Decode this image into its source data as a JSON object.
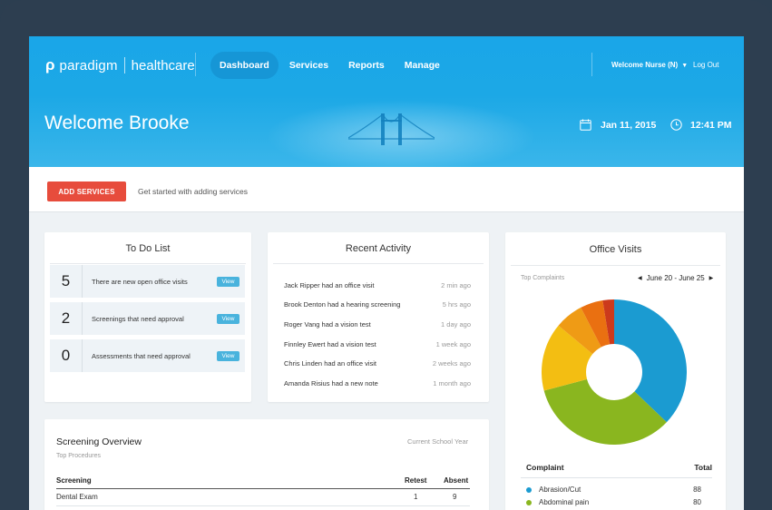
{
  "brand": {
    "logo_mark": "ρ",
    "name_part1": "paradigm",
    "name_part2": "healthcare"
  },
  "nav": {
    "items": [
      "Dashboard",
      "Services",
      "Reports",
      "Manage"
    ],
    "active": "Dashboard"
  },
  "user": {
    "welcome": "Welcome Nurse (N)",
    "logout": "Log Out"
  },
  "header": {
    "welcome": "Welcome Brooke",
    "date": "Jan 11, 2015",
    "time": "12:41 PM"
  },
  "actions": {
    "add_services": "ADD SERVICES",
    "hint": "Get started with adding services"
  },
  "todo": {
    "title": "To Do List",
    "items": [
      {
        "count": "5",
        "text": "There are new open office visits",
        "action": "View"
      },
      {
        "count": "2",
        "text": "Screenings that need approval",
        "action": "View"
      },
      {
        "count": "0",
        "text": "Assessments that need approval",
        "action": "View"
      }
    ]
  },
  "activity": {
    "title": "Recent Activity",
    "items": [
      {
        "text": "Jack Ripper had an office visit",
        "when": "2 min ago"
      },
      {
        "text": "Brook Denton had a hearing screening",
        "when": "5 hrs ago"
      },
      {
        "text": "Roger Vang had a vision test",
        "when": "1 day ago"
      },
      {
        "text": "Finnley Ewert had a vision test",
        "when": "1 week ago"
      },
      {
        "text": "Chris Linden had an office visit",
        "when": "2 weeks ago"
      },
      {
        "text": "Amanda Risius had a new note",
        "when": "1 month ago"
      }
    ]
  },
  "visits": {
    "title": "Office Visits",
    "subtitle": "Top Complaints",
    "range": "June 20 - June 25",
    "table_head": {
      "complaint": "Complaint",
      "total": "Total"
    },
    "rows": [
      {
        "label": "Abrasion/Cut",
        "total": "88",
        "color": "#1b9bd1"
      },
      {
        "label": "Abdominal pain",
        "total": "80",
        "color": "#8ab61f"
      }
    ]
  },
  "chart_data": {
    "type": "pie",
    "title": "Office Visits",
    "subtitle": "Top Complaints",
    "series": [
      {
        "name": "Abrasion/Cut",
        "value": 88,
        "color": "#1b9bd1"
      },
      {
        "name": "Abdominal pain",
        "value": 80,
        "color": "#8ab61f"
      },
      {
        "value": 36,
        "color": "#f3be12"
      },
      {
        "value": 15,
        "color": "#ef9b15"
      },
      {
        "value": 12,
        "color": "#ea7011"
      },
      {
        "value": 6,
        "color": "#cc3a1c"
      }
    ]
  },
  "overview": {
    "title": "Screening Overview",
    "subtitle": "Top Procedures",
    "filter": "Current School Year",
    "columns": [
      "Screening",
      "Retest",
      "Absent"
    ],
    "rows": [
      {
        "screening": "Dental Exam",
        "retest": "1",
        "absent": "9"
      }
    ]
  },
  "colors": {
    "brand_blue": "#1aa6e8",
    "accent_red": "#e74c3c",
    "view_blue": "#49b3dd"
  }
}
